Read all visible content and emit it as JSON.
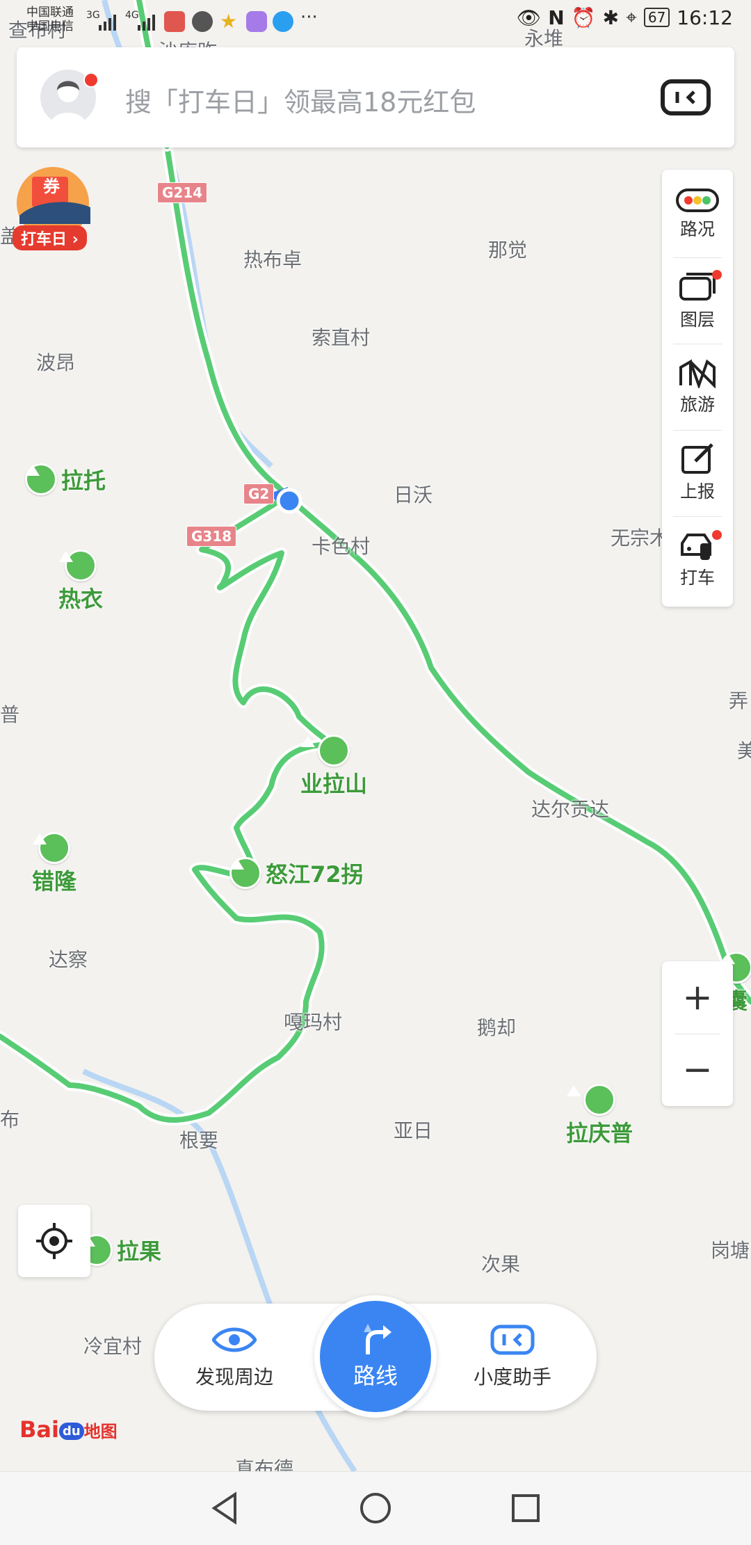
{
  "status_bar": {
    "carrier_line1": "中国联通",
    "carrier_line2": "中国电信",
    "net1": "3G",
    "net2": "4G",
    "battery": "67",
    "time": "16:12"
  },
  "search": {
    "placeholder": "搜「打车日」领最高18元红包",
    "avatar_icon": "user-avatar-icon",
    "assistant_icon": "xiaodu-assistant-icon"
  },
  "promo": {
    "badge": "券",
    "label": "打车日"
  },
  "right_toolbar": [
    {
      "id": "traffic",
      "label": "路况",
      "icon": "traffic-light-icon",
      "dot": false
    },
    {
      "id": "layers",
      "label": "图层",
      "icon": "layers-icon",
      "dot": true
    },
    {
      "id": "travel",
      "label": "旅游",
      "icon": "travel-icon",
      "dot": false
    },
    {
      "id": "report",
      "label": "上报",
      "icon": "report-icon",
      "dot": false
    },
    {
      "id": "taxi",
      "label": "打车",
      "icon": "taxi-icon",
      "dot": true
    }
  ],
  "zoom": {
    "in": "+",
    "out": "−"
  },
  "map": {
    "places": [
      {
        "text": "查布村"
      },
      {
        "text": "沙库昨"
      },
      {
        "text": "永堆"
      },
      {
        "text": "热布卓"
      },
      {
        "text": "那觉"
      },
      {
        "text": "索直村"
      },
      {
        "text": "波昂"
      },
      {
        "text": "日沃"
      },
      {
        "text": "卡色村"
      },
      {
        "text": "无宗木"
      },
      {
        "text": "弄"
      },
      {
        "text": "美"
      },
      {
        "text": "普"
      },
      {
        "text": "达尔贡达"
      },
      {
        "text": "达察"
      },
      {
        "text": "嘎玛村"
      },
      {
        "text": "鹅却"
      },
      {
        "text": "布"
      },
      {
        "text": "亚日"
      },
      {
        "text": "根要"
      },
      {
        "text": "次果"
      },
      {
        "text": "岗塘"
      },
      {
        "text": "冷宜村"
      },
      {
        "text": "真布德"
      },
      {
        "text": "盖"
      }
    ],
    "pois": [
      {
        "text": "拉托"
      },
      {
        "text": "热衣"
      },
      {
        "text": "业拉山"
      },
      {
        "text": "怒江72拐"
      },
      {
        "text": "错隆"
      },
      {
        "text": "拉庆普"
      },
      {
        "text": "拉果"
      },
      {
        "text": "囊"
      }
    ],
    "shields": [
      "G214",
      "G2",
      "G318"
    ]
  },
  "bottom_bar": {
    "discover": {
      "label": "发现周边",
      "icon": "eye-icon"
    },
    "route": {
      "label": "路线",
      "icon": "route-arrow-icon"
    },
    "assistant": {
      "label": "小度助手",
      "icon": "xiaodu-assistant-icon"
    }
  },
  "logo": {
    "bai": "Bai",
    "du": "du",
    "map": "地图"
  },
  "colors": {
    "route_green": "#58cc74",
    "river_blue": "#b7d5f5",
    "accent_blue": "#3a85f2",
    "poi_green": "#3d9a3a",
    "notification_red": "#f03a2f"
  }
}
